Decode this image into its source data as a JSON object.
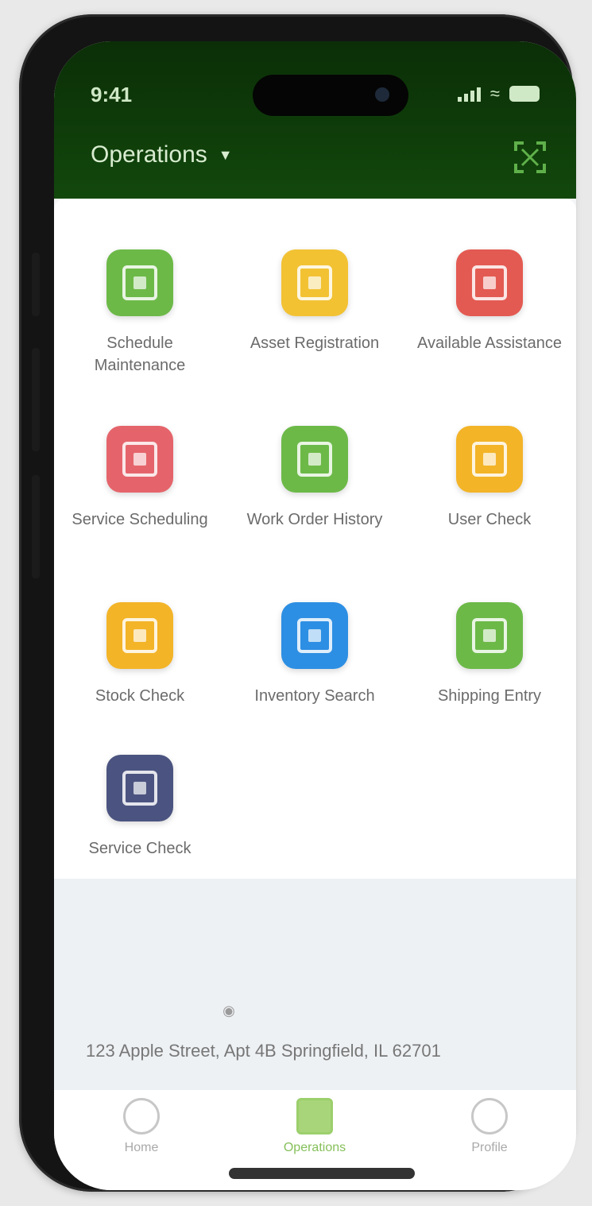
{
  "status_bar": {
    "time": "9:41"
  },
  "header": {
    "title": "Operations"
  },
  "tiles": [
    {
      "label": "Schedule Maintenance",
      "color": "#6cb948"
    },
    {
      "label": "Asset Registration",
      "color": "#f2c233"
    },
    {
      "label": "Available Assistance",
      "color": "#e35a52"
    },
    {
      "label": "Service Scheduling",
      "color": "#e5646b"
    },
    {
      "label": "Work Order History",
      "color": "#6cb948"
    },
    {
      "label": "User Check",
      "color": "#f3b428"
    },
    {
      "label": "Stock Check",
      "color": "#f3b428"
    },
    {
      "label": "Inventory Search",
      "color": "#2d8fe3"
    },
    {
      "label": "Shipping Entry",
      "color": "#6cb948"
    },
    {
      "label": "Service Check",
      "color": "#4b5480"
    }
  ],
  "address": "123 Apple Street, Apt 4B Springfield, IL 62701",
  "tabs": [
    {
      "label": "Home"
    },
    {
      "label": "Operations"
    },
    {
      "label": "Profile"
    }
  ]
}
